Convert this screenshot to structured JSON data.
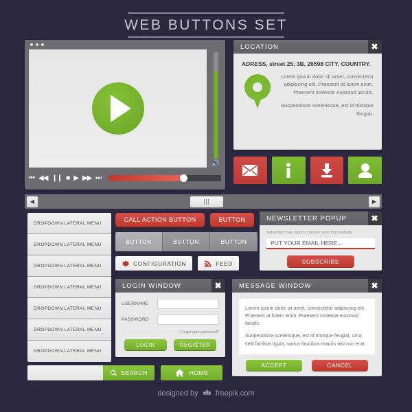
{
  "title": "WEB BUTTONS SET",
  "player": {
    "controls": [
      {
        "name": "skip-back",
        "glyph": "⏮"
      },
      {
        "name": "rewind",
        "glyph": "◀◀"
      },
      {
        "name": "pause",
        "glyph": "❙❙"
      },
      {
        "name": "stop",
        "glyph": "■"
      },
      {
        "name": "play",
        "glyph": "▶"
      },
      {
        "name": "fast-forward",
        "glyph": "▶▶"
      },
      {
        "name": "skip-forward",
        "glyph": "⏭"
      }
    ],
    "volume_icon": "🔊"
  },
  "location": {
    "title": "LOCATION",
    "close": "✖",
    "address": "ADRESS, street 25, 3B, 26598 CITY, COUNTRY.",
    "paragraph1": "Lorem ipsum dolor sit amet, consectetur adipiscing elit. Praesent at lorem enim. Praesent molestie euismod iaculis.",
    "paragraph2": "Suspendisse scelerisque, est id tristique feugiat."
  },
  "icon_buttons": [
    {
      "name": "mail-icon",
      "color": "red"
    },
    {
      "name": "info-icon",
      "color": "green"
    },
    {
      "name": "download-icon",
      "color": "red"
    },
    {
      "name": "user-icon",
      "color": "green"
    }
  ],
  "scrollbar": {
    "left_arrow": "◀",
    "right_arrow": "▶"
  },
  "dropdown_menu": {
    "items": [
      "DROPDOWN LATERAL MENU",
      "DROPDOWN LATERAL MENU",
      "DROPDOWN LATERAL MENU",
      "DROPDOWN LATERAL MENU",
      "DROPDOWN LATERAL MENU",
      "DROPDOWN LATERAL MENU",
      "DROPDOWN LATERAL MENU"
    ]
  },
  "buttons": {
    "call_action": "CALL ACTION BUTTON",
    "small_red": "BUTTON",
    "segmented": [
      "BUTTON",
      "BUTTON",
      "BUTTON"
    ],
    "configuration": "CONFIGURATION",
    "feed": "FEED"
  },
  "newsletter": {
    "title": "NEWSLETTER POPUP",
    "close": "✖",
    "subtitle": "Subscribe if you want to receive news from website",
    "email_placeholder": "PUT YOUR EMAIL HERE...",
    "subscribe": "SUBSCRIBE"
  },
  "login": {
    "title": "LOGIN WINDOW",
    "close": "✖",
    "username_label": "USERNAME",
    "username_value": "",
    "password_label": "PASSWORD",
    "password_value": "",
    "forgot": "Forgot your password?",
    "login_button": "LOGIN",
    "register_button": "REGISTER"
  },
  "message": {
    "title": "MESSAGE WINDOW",
    "close": "✖",
    "paragraph1": "Lorem ipsum dolor sit amet, consectetur adipiscing elit. Praesent at lorem enim. Praesent molestie euismod iaculis.",
    "paragraph2": "Suspendisse scelerisque, est id tristique feugiat, urna velit facilisis ligula, varius faucibus mauris nisi non erat.",
    "accept": "ACCEPT",
    "cancel": "CANCEL"
  },
  "search": {
    "value": "",
    "search_button": "SEARCH",
    "home_button": "HOME"
  },
  "footer": {
    "prefix": "designed by",
    "suffix": "freepik.com"
  },
  "colors": {
    "background": "#2b2840",
    "green": "#7cb82f",
    "red": "#c0392b",
    "panel": "#e9e9e9",
    "titlebar": "#6e6e72"
  }
}
